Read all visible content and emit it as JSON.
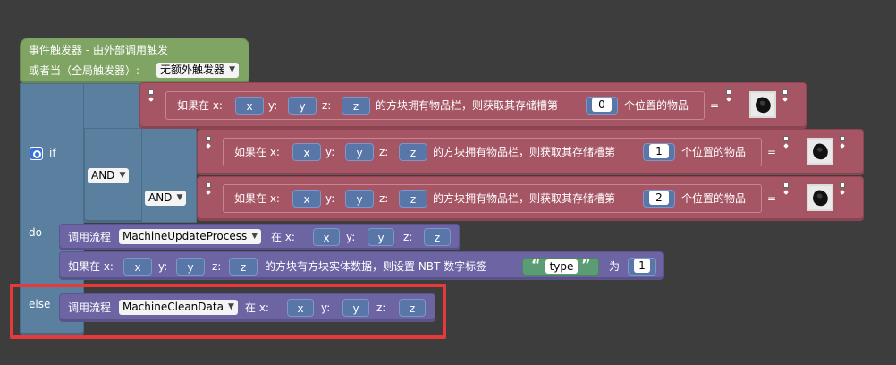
{
  "event": {
    "line1": "事件触发器 - 由外部调用触发",
    "line2_prefix": "或者当（全局触发器）:",
    "trigger_value": "无额外触发器"
  },
  "logic": {
    "if_label": "if",
    "do_label": "do",
    "else_label": "else",
    "and_label": "AND"
  },
  "cond": {
    "prefix": "如果在 x:",
    "y_label": "y:",
    "z_label": "z:",
    "mid": "的方块拥有物品栏，则获取其存储槽第",
    "suffix": "个位置的物品",
    "eq": "=",
    "var_x": "x",
    "var_y": "y",
    "var_z": "z",
    "slots": [
      "0",
      "1",
      "2"
    ]
  },
  "do_block": {
    "call_label": "调用流程",
    "proc1": "MachineUpdateProcess",
    "at_x": "在  x:",
    "y_label": "y:",
    "z_label": "z:",
    "nbt_prefix": "如果在 x:",
    "nbt_mid": "的方块有方块实体数据，则设置 NBT 数字标签",
    "nbt_tag": "type",
    "nbt_to": "为",
    "nbt_value": "1",
    "open_quote": "“",
    "close_quote": "”"
  },
  "else_block": {
    "call_label": "调用流程",
    "proc2": "MachineCleanData",
    "at_x": "在  x:",
    "y_label": "y:",
    "z_label": "z:"
  },
  "colors": {
    "event_block": "#7fa463",
    "logic_block": "#5a7f9f",
    "compare_block": "#a55563",
    "procedure_block": "#6d64a3",
    "highlight": "#e8393a"
  }
}
